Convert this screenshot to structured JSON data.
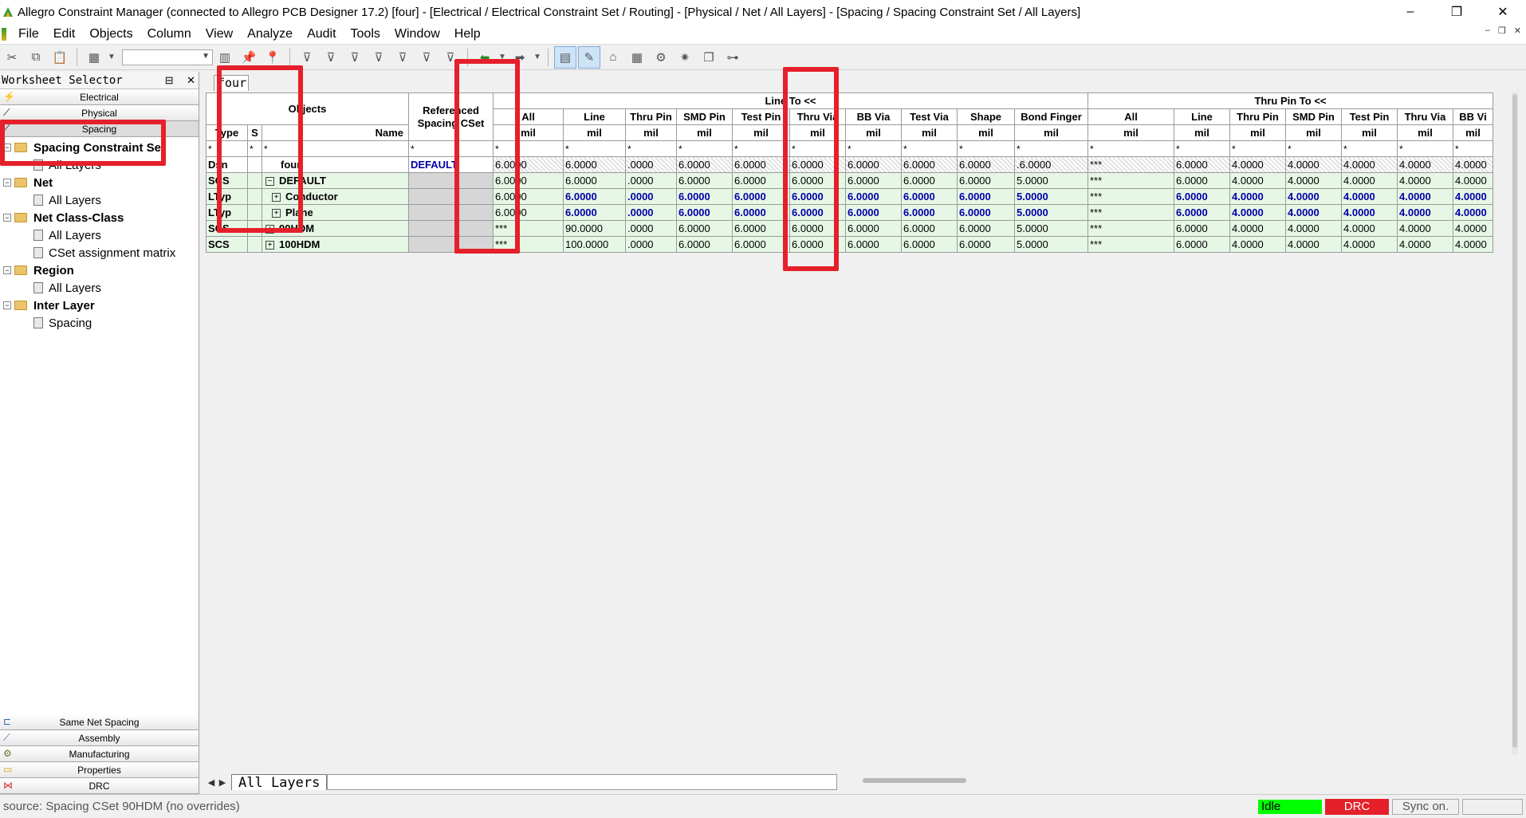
{
  "window": {
    "title": "Allegro Constraint Manager (connected to Allegro PCB Designer 17.2) [four] - [Electrical / Electrical Constraint Set / Routing] - [Physical / Net / All Layers] - [Spacing / Spacing Constraint Set / All Layers]",
    "minimize": "–",
    "restore": "❐",
    "close": "✕"
  },
  "menu": [
    "File",
    "Edit",
    "Objects",
    "Column",
    "View",
    "Analyze",
    "Audit",
    "Tools",
    "Window",
    "Help"
  ],
  "worksheet": {
    "header": "Worksheet Selector",
    "pin": "⊟",
    "close": "✕",
    "top_tabs": [
      "Electrical",
      "Physical",
      "Spacing"
    ],
    "tree": [
      {
        "label": "Spacing Constraint Set",
        "level": 0
      },
      {
        "label": "All Layers",
        "level": 1
      },
      {
        "label": "Net",
        "level": 0
      },
      {
        "label": "All Layers",
        "level": 1
      },
      {
        "label": "Net Class-Class",
        "level": 0
      },
      {
        "label": "All Layers",
        "level": 1
      },
      {
        "label": "CSet assignment matrix",
        "level": 1
      },
      {
        "label": "Region",
        "level": 0
      },
      {
        "label": "All Layers",
        "level": 1
      },
      {
        "label": "Inter Layer",
        "level": 0
      },
      {
        "label": "Spacing",
        "level": 1
      }
    ],
    "bottom_tabs": [
      "Same Net Spacing",
      "Assembly",
      "Manufacturing",
      "Properties",
      "DRC"
    ]
  },
  "doc_tab": "four",
  "grid": {
    "group_headers": {
      "objects": "Objects",
      "refcset": "Referenced Spacing CSet",
      "line_to": "Line To <<",
      "thru_pin_to": "Thru Pin To <<"
    },
    "sub_headers": {
      "type": "Type",
      "s": "S",
      "name": "Name"
    },
    "line_cols": [
      "All",
      "Line",
      "Thru Pin",
      "SMD Pin",
      "Test Pin",
      "Thru Via",
      "BB Via",
      "Test Via",
      "Shape",
      "Bond Finger"
    ],
    "thru_cols": [
      "All",
      "Line",
      "Thru Pin",
      "SMD Pin",
      "Test Pin",
      "Thru Via",
      "BB Vi"
    ],
    "unit": "mil",
    "filter": "*",
    "rows": [
      {
        "type": "Dsn",
        "name": "four",
        "exp": "",
        "indent": 0,
        "ref": "DEFAULT",
        "line": [
          "6.0000",
          "6.0000",
          ".0000",
          "6.0000",
          "6.0000",
          "6.0000",
          "6.0000",
          "6.0000",
          "6.0000",
          ".6.0000"
        ],
        "thru": [
          "***",
          "6.0000",
          "4.0000",
          "4.0000",
          "4.0000",
          "4.0000",
          "4.0000"
        ]
      },
      {
        "type": "SCS",
        "name": "DEFAULT",
        "exp": "−",
        "indent": 0,
        "ref": "",
        "line": [
          "6.0000",
          "6.0000",
          ".0000",
          "6.0000",
          "6.0000",
          "6.0000",
          "6.0000",
          "6.0000",
          "6.0000",
          "5.0000"
        ],
        "thru": [
          "***",
          "6.0000",
          "4.0000",
          "4.0000",
          "4.0000",
          "4.0000",
          "4.0000"
        ]
      },
      {
        "type": "LTyp",
        "name": "Conductor",
        "exp": "+",
        "indent": 1,
        "ref": "",
        "line": [
          "6.0000",
          "6.0000",
          ".0000",
          "6.0000",
          "6.0000",
          "6.0000",
          "6.0000",
          "6.0000",
          "6.0000",
          "5.0000"
        ],
        "thru": [
          "***",
          "6.0000",
          "4.0000",
          "4.0000",
          "4.0000",
          "4.0000",
          "4.0000"
        ]
      },
      {
        "type": "LTyp",
        "name": "Plane",
        "exp": "+",
        "indent": 1,
        "ref": "",
        "line": [
          "6.0000",
          "6.0000",
          ".0000",
          "6.0000",
          "6.0000",
          "6.0000",
          "6.0000",
          "6.0000",
          "6.0000",
          "5.0000"
        ],
        "thru": [
          "***",
          "6.0000",
          "4.0000",
          "4.0000",
          "4.0000",
          "4.0000",
          "4.0000"
        ]
      },
      {
        "type": "SCS",
        "name": "90HDM",
        "exp": "+",
        "indent": 0,
        "ref": "",
        "line": [
          "***",
          "90.0000",
          ".0000",
          "6.0000",
          "6.0000",
          "6.0000",
          "6.0000",
          "6.0000",
          "6.0000",
          "5.0000"
        ],
        "thru": [
          "***",
          "6.0000",
          "4.0000",
          "4.0000",
          "4.0000",
          "4.0000",
          "4.0000"
        ]
      },
      {
        "type": "SCS",
        "name": "100HDM",
        "exp": "+",
        "indent": 0,
        "ref": "",
        "line": [
          "***",
          "100.0000",
          ".0000",
          "6.0000",
          "6.0000",
          "6.0000",
          "6.0000",
          "6.0000",
          "6.0000",
          "5.0000"
        ],
        "thru": [
          "***",
          "6.0000",
          "4.0000",
          "4.0000",
          "4.0000",
          "4.0000",
          "4.0000"
        ]
      }
    ]
  },
  "sheet_tab": "All Layers",
  "status": {
    "source": "source: Spacing CSet 90HDM (no overrides)",
    "idle": "Idle",
    "drc": "DRC",
    "sync": "Sync on."
  }
}
